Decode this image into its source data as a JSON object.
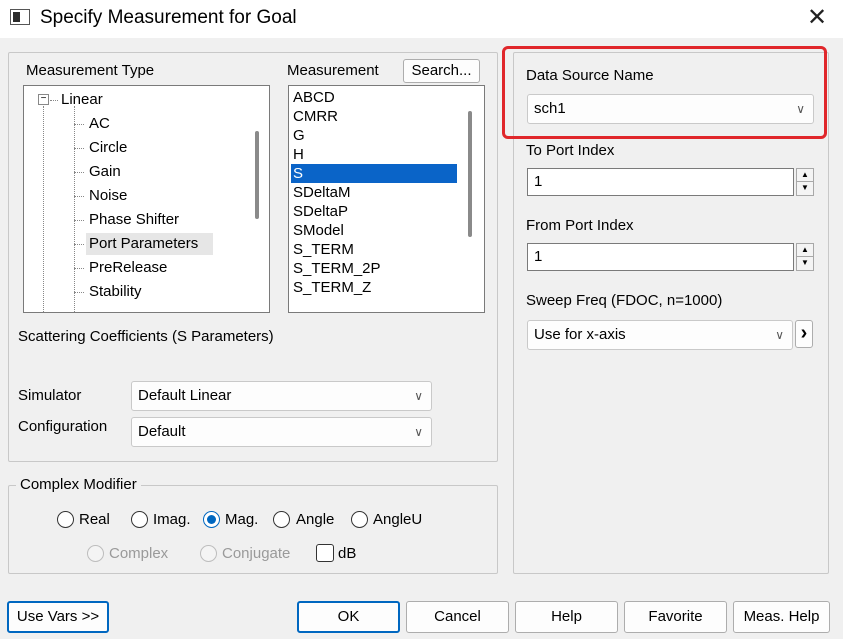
{
  "window": {
    "title": "Specify Measurement for Goal",
    "close_glyph": "✕"
  },
  "measurement_type": {
    "label": "Measurement Type",
    "tree_root": "Linear",
    "items": [
      "AC",
      "Circle",
      "Gain",
      "Noise",
      "Phase Shifter",
      "Port Parameters",
      "PreRelease",
      "Stability"
    ]
  },
  "measurement": {
    "label": "Measurement",
    "search_label": "Search...",
    "items": [
      "ABCD",
      "CMRR",
      "G",
      "H",
      "S",
      "SDeltaM",
      "SDeltaP",
      "SModel",
      "S_TERM",
      "S_TERM_2P",
      "S_TERM_Z"
    ],
    "selected": "S"
  },
  "description": "Scattering Coefficients (S Parameters)",
  "simulator": {
    "label": "Simulator",
    "value": "Default Linear"
  },
  "configuration": {
    "label": "Configuration",
    "value": "Default"
  },
  "complex_modifier": {
    "label": "Complex Modifier",
    "options": [
      "Real",
      "Imag.",
      "Mag.",
      "Angle",
      "AngleU"
    ],
    "selected": "Mag.",
    "disabled_options": [
      "Complex",
      "Conjugate"
    ],
    "db_label": "dB",
    "db_checked": false
  },
  "data_source": {
    "label": "Data Source Name",
    "value": "sch1"
  },
  "to_port": {
    "label": "To Port Index",
    "value": "1"
  },
  "from_port": {
    "label": "From Port Index",
    "value": "1"
  },
  "sweep": {
    "label": "Sweep Freq  (FDOC, n=1000)",
    "value": "Use for x-axis",
    "more_glyph": "›"
  },
  "buttons": {
    "use_vars": "Use Vars >>",
    "ok": "OK",
    "cancel": "Cancel",
    "help": "Help",
    "favorite": "Favorite",
    "meas_help": "Meas. Help"
  },
  "colors": {
    "selection": "#0a64c8",
    "highlight": "#e0272b",
    "accent": "#0067c0"
  }
}
